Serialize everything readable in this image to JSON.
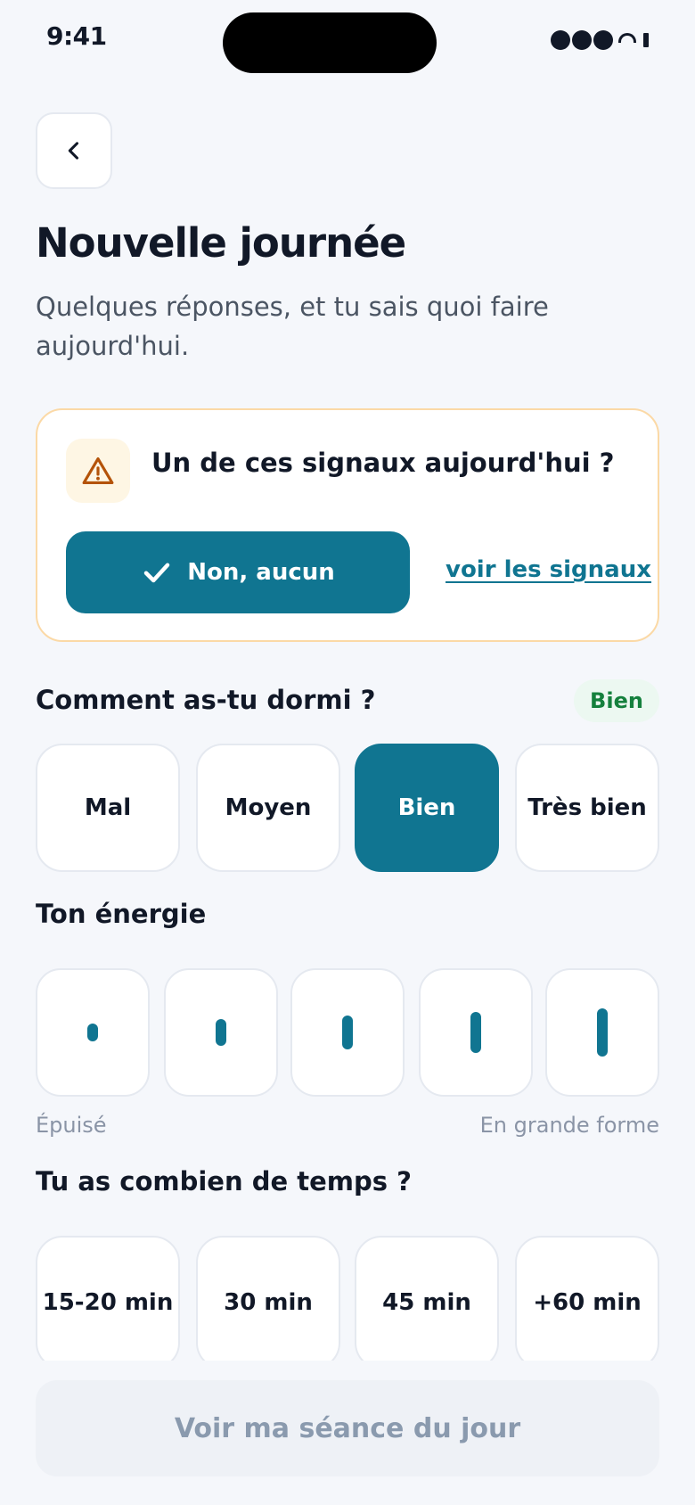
{
  "status_bar": {
    "time": "9:41"
  },
  "header": {
    "title": "Nouvelle journée",
    "subtitle": "Quelques réponses, et tu sais quoi faire aujourd'hui."
  },
  "signals_card": {
    "question": "Un de ces signaux aujourd'hui ?",
    "none_button": "Non, aucun",
    "see_link": "voir les signaux"
  },
  "sleep": {
    "question": "Comment as-tu dormi ?",
    "badge": "Bien",
    "options": [
      "Mal",
      "Moyen",
      "Bien",
      "Très bien"
    ],
    "selected": "Bien"
  },
  "energy": {
    "question": "Ton énergie",
    "levels": [
      1,
      2,
      3,
      4,
      5
    ],
    "min_label": "Épuisé",
    "max_label": "En grande forme"
  },
  "time": {
    "question": "Tu as combien de temps ?",
    "options": [
      "15-20 min",
      "30 min",
      "45 min",
      "+60 min"
    ]
  },
  "cta": {
    "label": "Voir ma séance du jour"
  },
  "colors": {
    "accent": "#107591",
    "warning": "#B45309",
    "success": "#15803D",
    "background": "#F5F7FB"
  },
  "icons": {
    "back": "chevron-left-icon",
    "warning": "warning-triangle-icon",
    "check": "check-icon"
  }
}
